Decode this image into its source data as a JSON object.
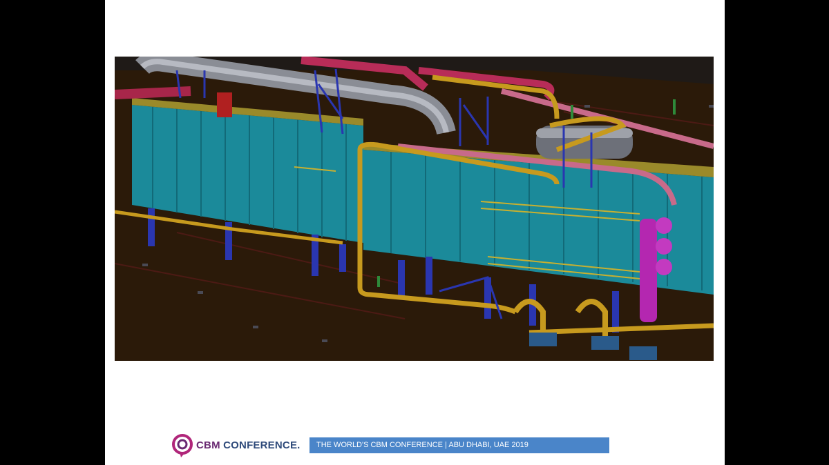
{
  "slide": {
    "image": {
      "description_icon": "industrial-plant-3d-model-icon"
    },
    "footer": {
      "logo_icon": "cbm-conference-logo-icon",
      "brand_cbm": "CBM",
      "brand_rest": "CONFERENCE.",
      "banner_text": "THE  WORLD'S CBM CONFERENCE  |  ABU DHABI, UAE  2019"
    }
  },
  "colors": {
    "background": "#000000",
    "slide": "#ffffff",
    "banner": "#4a85c9",
    "logo": "#b0267a"
  }
}
